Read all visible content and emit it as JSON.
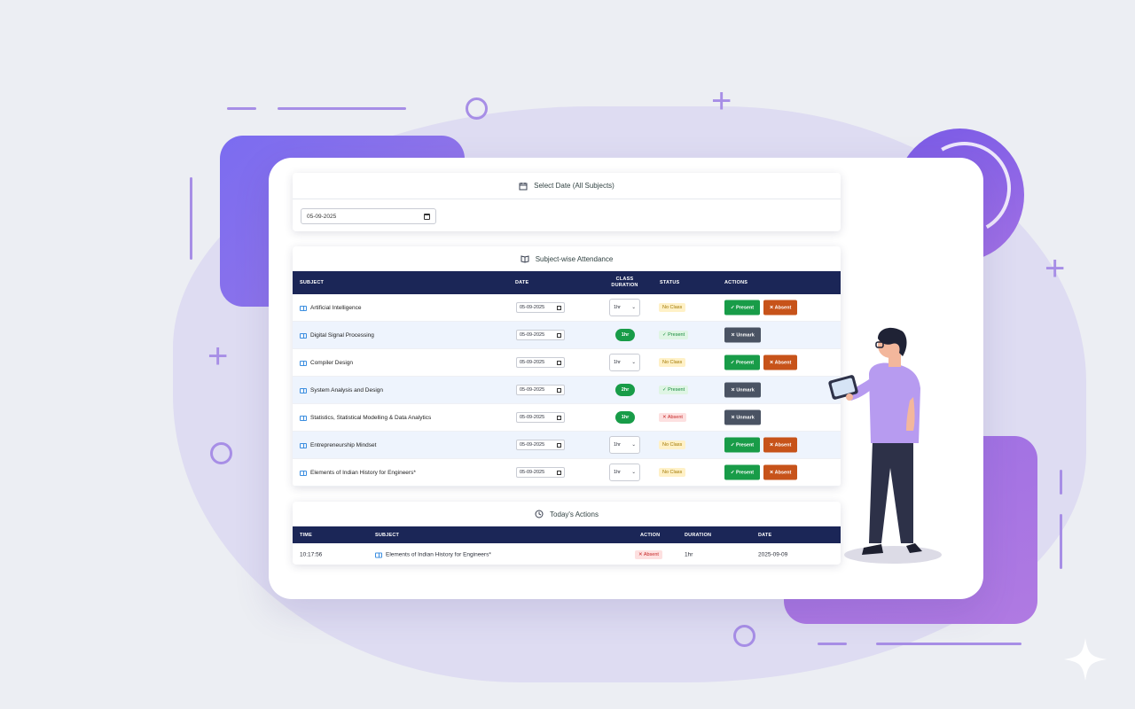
{
  "date_panel": {
    "title": "Select Date (All Subjects)",
    "date_value": "05-09-2025"
  },
  "subject_panel": {
    "title": "Subject-wise Attendance",
    "columns": {
      "subject": "SUBJECT",
      "date": "DATE",
      "duration": "CLASS DURATION",
      "status": "STATUS",
      "actions": "ACTIONS"
    },
    "rows": [
      {
        "subject": "Artificial Intelligence",
        "date": "05-09-2025",
        "duration": "1hr",
        "duration_mode": "select",
        "status": "No Class",
        "status_kind": "noclass",
        "action_mode": "mark"
      },
      {
        "subject": "Digital Signal Processing",
        "date": "05-09-2025",
        "duration": "1hr",
        "duration_mode": "pill",
        "status": "✓ Present",
        "status_kind": "present",
        "action_mode": "unmark"
      },
      {
        "subject": "Compiler Design",
        "date": "05-09-2025",
        "duration": "1hr",
        "duration_mode": "select",
        "status": "No Class",
        "status_kind": "noclass",
        "action_mode": "mark"
      },
      {
        "subject": "System Analysis and Design",
        "date": "05-09-2025",
        "duration": "2hr",
        "duration_mode": "pill",
        "status": "✓ Present",
        "status_kind": "present",
        "action_mode": "unmark"
      },
      {
        "subject": "Statistics, Statistical Modelling & Data Analytics",
        "date": "05-09-2025",
        "duration": "1hr",
        "duration_mode": "pill",
        "status": "✕ Absent",
        "status_kind": "absent",
        "action_mode": "unmark"
      },
      {
        "subject": "Entrepreneurship Mindset",
        "date": "05-09-2025",
        "duration": "1hr",
        "duration_mode": "select",
        "status": "No Class",
        "status_kind": "noclass",
        "action_mode": "mark"
      },
      {
        "subject": "Elements of Indian History for Engineers*",
        "date": "05-09-2025",
        "duration": "1hr",
        "duration_mode": "select",
        "status": "No Class",
        "status_kind": "noclass",
        "action_mode": "mark"
      }
    ],
    "present_label": "✓ Present",
    "absent_label": "✕ Absent",
    "unmark_label": "✕ Unmark"
  },
  "today_panel": {
    "title": "Today's Actions",
    "columns": {
      "time": "TIME",
      "subject": "SUBJECT",
      "action": "ACTION",
      "duration": "DURATION",
      "date": "DATE"
    },
    "rows": [
      {
        "time": "10:17:56",
        "subject": "Elements of Indian History for Engineers*",
        "action": "✕ Absent",
        "duration": "1hr",
        "date": "2025-09-09"
      }
    ]
  },
  "colors": {
    "header_navy": "#1b2657",
    "present_green": "#189c48",
    "absent_orange": "#c7531a",
    "unmark_gray": "#4a5363",
    "accent_purple": "#a78ee6"
  },
  "icons": {
    "date_panel": "calendar-icon",
    "subject_panel": "book-icon",
    "today_panel": "clock-icon"
  }
}
